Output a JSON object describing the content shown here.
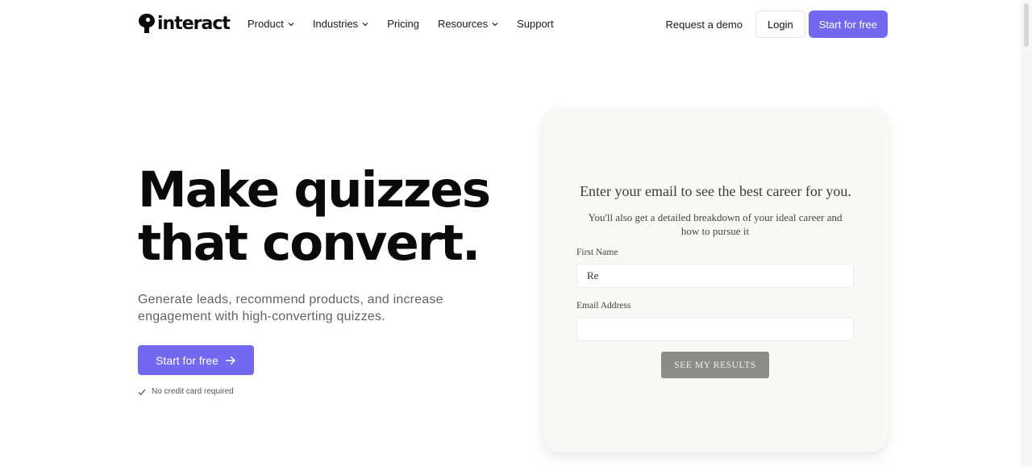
{
  "header": {
    "logo_text": "interact",
    "nav": [
      {
        "label": "Product",
        "has_dropdown": true
      },
      {
        "label": "Industries",
        "has_dropdown": true
      },
      {
        "label": "Pricing",
        "has_dropdown": false
      },
      {
        "label": "Resources",
        "has_dropdown": true
      },
      {
        "label": "Support",
        "has_dropdown": false
      }
    ],
    "demo_label": "Request a demo",
    "login_label": "Login",
    "start_label": "Start for free"
  },
  "hero": {
    "title_line1": "Make quizzes",
    "title_line2": "that convert.",
    "subtitle": "Generate leads, recommend products, and increase engagement with high-converting quizzes.",
    "cta_label": "Start for free",
    "note": "No credit card required"
  },
  "quiz_card": {
    "title": "Enter your email to see the best career for you.",
    "description": "You'll also get a detailed breakdown of your ideal career and how to pursue it",
    "first_name_label": "First Name",
    "first_name_value": "Re",
    "email_label": "Email Address",
    "email_value": "",
    "submit_label": "SEE MY RESULTS"
  },
  "colors": {
    "accent": "#7269f0",
    "card_bg": "#f8f8f7",
    "submit_bg": "#8b8b87"
  },
  "icons": [
    "interact-logo-icon",
    "chevron-down-icon",
    "arrow-right-icon",
    "check-icon"
  ]
}
